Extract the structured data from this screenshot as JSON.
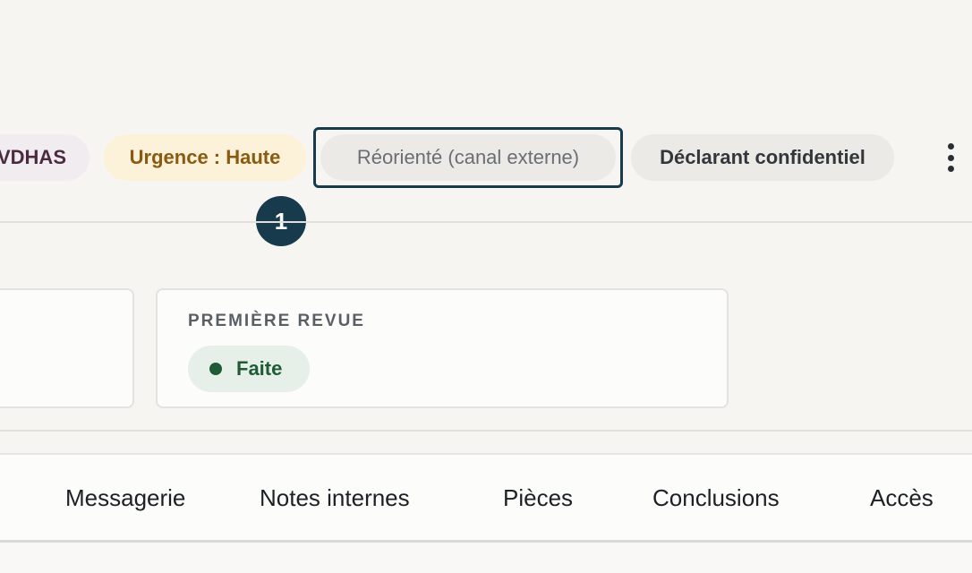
{
  "chips": {
    "vdhas": "VDHAS",
    "urgence": "Urgence : Haute",
    "reoriente": "Réorienté (canal externe)",
    "declarant": "Déclarant confidentiel"
  },
  "step_badge": "1",
  "review_card": {
    "label": "PREMIÈRE REVUE",
    "status": "Faite"
  },
  "tabs": [
    {
      "label": "Messagerie"
    },
    {
      "label": "Notes internes"
    },
    {
      "label": "Pièces"
    },
    {
      "label": "Conclusions"
    },
    {
      "label": "Accès"
    }
  ],
  "icons": {
    "more": "kebab-vertical-icon"
  },
  "colors": {
    "focus_border": "#173a4d",
    "urgence_bg": "#fcf1d9",
    "urgence_text": "#8a5a10",
    "status_done": "#1f5c36"
  }
}
